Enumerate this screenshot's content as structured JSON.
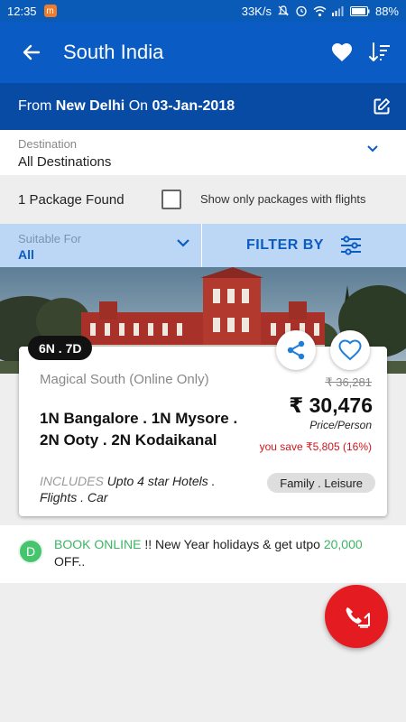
{
  "status_bar": {
    "time": "12:35",
    "notification_badge": "m",
    "network_speed": "33K/s",
    "battery": "88%"
  },
  "app_bar": {
    "title": "South India",
    "icons": [
      "back-arrow-icon",
      "heart-icon",
      "sort-icon"
    ]
  },
  "trip": {
    "from_label": "From",
    "from_city": "New Delhi",
    "on_label": "On",
    "date": "03-Jan-2018"
  },
  "destination": {
    "label": "Destination",
    "value": "All Destinations"
  },
  "results": {
    "count_text": "1 Package Found",
    "flights_filter_label": "Show only packages with flights",
    "flights_filter_checked": false
  },
  "filters": {
    "suitable_for_label": "Suitable For",
    "suitable_for_value": "All",
    "filter_by_label": "FILTER BY"
  },
  "package": {
    "duration": "6N . 7D",
    "name": "Magical South (Online Only)",
    "itinerary": "1N Bangalore . 1N Mysore . 2N Ooty . 2N Kodaikanal",
    "original_price": "₹ 36,281",
    "price": "₹ 30,476",
    "price_unit": "Price/Person",
    "savings": "you save ₹5,805 (16%)",
    "includes_label": "INCLUDES",
    "includes_text": "Upto 4 star Hotels . Flights . Car",
    "tag": "Family . Leisure"
  },
  "offer": {
    "avatar_letter": "D",
    "highlight_1": "BOOK ONLINE",
    "text_1": " !! New Year holidays & get utpo ",
    "highlight_2": "20,000",
    "text_2": " OFF.."
  },
  "colors": {
    "primary": "#0a5bc4",
    "sub_bar": "#084ba5",
    "filter_bg": "#bcd7f5",
    "accent_red": "#e41c22",
    "offer_green": "#3cb563"
  }
}
